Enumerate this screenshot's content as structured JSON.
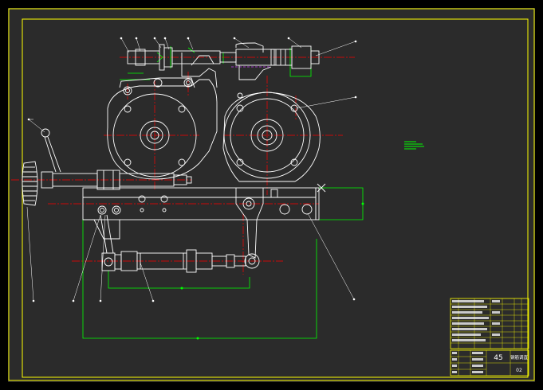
{
  "drawing": {
    "background": "#000000",
    "sheet_color": "#2b2b2b",
    "frame_color": "#ffff00",
    "outline_color": "#ffffff",
    "centerline_color": "#ff0000",
    "dimension_color": "#00ff00",
    "hidden_color": "#cc44ff",
    "leader_color": "#ffffff"
  },
  "title_block": {
    "cell_big": "45",
    "cell_name": "钢筋调直",
    "cell_code": "02"
  }
}
